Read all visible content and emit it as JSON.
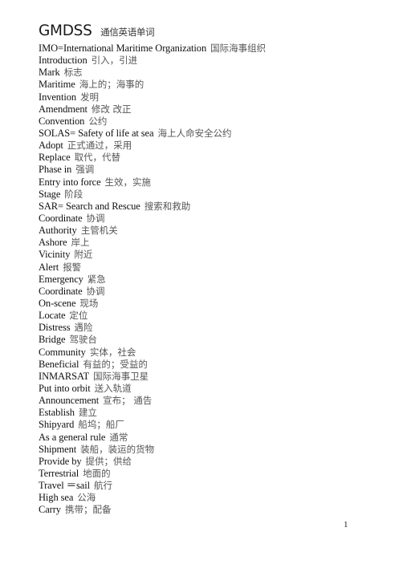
{
  "document": {
    "title_en": "GMDSS",
    "title_zh": "通信英语单词",
    "page_number": "1",
    "entries": [
      {
        "en": "IMO=International Maritime Organization",
        "zh": "国际海事组织"
      },
      {
        "en": "Introduction",
        "zh": "引入，引进"
      },
      {
        "en": "Mark",
        "zh": "标志"
      },
      {
        "en": "Maritime",
        "zh": "海上的；海事的"
      },
      {
        "en": "Invention",
        "zh": "发明"
      },
      {
        "en": "Amendment",
        "zh": "修改 改正"
      },
      {
        "en": "Convention",
        "zh": "公约"
      },
      {
        "en": "SOLAS= Safety of life at sea",
        "zh": "海上人命安全公约"
      },
      {
        "en": "Adopt",
        "zh": "正式通过，采用"
      },
      {
        "en": "Replace",
        "zh": "取代，代替"
      },
      {
        "en": "Phase in",
        "zh": "强调"
      },
      {
        "en": "Entry into force",
        "zh": "生效，实施"
      },
      {
        "en": "Stage",
        "zh": "阶段"
      },
      {
        "en": "SAR= Search and Rescue",
        "zh": "搜索和救助"
      },
      {
        "en": "Coordinate",
        "zh": "协调"
      },
      {
        "en": "Authority",
        "zh": "主管机关"
      },
      {
        "en": "Ashore",
        "zh": "岸上"
      },
      {
        "en": "Vicinity",
        "zh": "附近"
      },
      {
        "en": "Alert",
        "zh": "报警"
      },
      {
        "en": "Emergency",
        "zh": "紧急"
      },
      {
        "en": "Coordinate",
        "zh": "协调"
      },
      {
        "en": "On-scene",
        "zh": "现场"
      },
      {
        "en": "Locate",
        "zh": "定位"
      },
      {
        "en": "Distress",
        "zh": "遇险"
      },
      {
        "en": "Bridge",
        "zh": "驾驶台"
      },
      {
        "en": "Community",
        "zh": "实体，社会"
      },
      {
        "en": "Beneficial",
        "zh": "有益的；受益的"
      },
      {
        "en": "INMARSAT",
        "zh": "国际海事卫星"
      },
      {
        "en": "Put into orbit",
        "zh": "送入轨道"
      },
      {
        "en": "Announcement",
        "zh": "宣布；  通告"
      },
      {
        "en": "Establish",
        "zh": "建立"
      },
      {
        "en": "Shipyard",
        "zh": "船坞；船厂"
      },
      {
        "en": "As a general rule",
        "zh": "通常"
      },
      {
        "en": "Shipment",
        "zh": "装船，装运的货物"
      },
      {
        "en": "Provide by",
        "zh": "提供；供给"
      },
      {
        "en": "Terrestrial",
        "zh": "地面的"
      },
      {
        "en": "Travel  ＝sail",
        "zh": "航行"
      },
      {
        "en": "High sea",
        "zh": "公海"
      },
      {
        "en": "Carry",
        "zh": "携带；配备"
      }
    ]
  }
}
